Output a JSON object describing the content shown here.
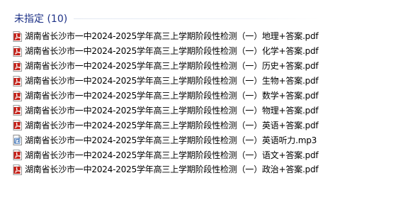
{
  "group": {
    "title": "未指定 (10)"
  },
  "colors": {
    "group_title": "#1e3287",
    "pdf_icon": "#c41e16",
    "mp3_icon": "#3a6fb4"
  },
  "files": [
    {
      "name": "湖南省长沙市一中2024-2025学年高三上学期阶段性检测（一）地理+答案.pdf",
      "type": "pdf",
      "icon": "pdf-icon"
    },
    {
      "name": "湖南省长沙市一中2024-2025学年高三上学期阶段性检测（一）化学+答案.pdf",
      "type": "pdf",
      "icon": "pdf-icon"
    },
    {
      "name": "湖南省长沙市一中2024-2025学年高三上学期阶段性检测（一）历史+答案.pdf",
      "type": "pdf",
      "icon": "pdf-icon"
    },
    {
      "name": "湖南省长沙市一中2024-2025学年高三上学期阶段性检测（一）生物+答案.pdf",
      "type": "pdf",
      "icon": "pdf-icon"
    },
    {
      "name": "湖南省长沙市一中2024-2025学年高三上学期阶段性检测（一）数学+答案.pdf",
      "type": "pdf",
      "icon": "pdf-icon"
    },
    {
      "name": "湖南省长沙市一中2024-2025学年高三上学期阶段性检测（一）物理+答案.pdf",
      "type": "pdf",
      "icon": "pdf-icon"
    },
    {
      "name": "湖南省长沙市一中2024-2025学年高三上学期阶段性检测（一）英语+答案.pdf",
      "type": "pdf",
      "icon": "pdf-icon"
    },
    {
      "name": "湖南省长沙市一中2024-2025学年高三上学期阶段性检测（一）英语听力.mp3",
      "type": "mp3",
      "icon": "audio-file-icon"
    },
    {
      "name": "湖南省长沙市一中2024-2025学年高三上学期阶段性检测（一）语文+答案.pdf",
      "type": "pdf",
      "icon": "pdf-icon"
    },
    {
      "name": "湖南省长沙市一中2024-2025学年高三上学期阶段性检测（一）政治+答案.pdf",
      "type": "pdf",
      "icon": "pdf-icon"
    }
  ]
}
